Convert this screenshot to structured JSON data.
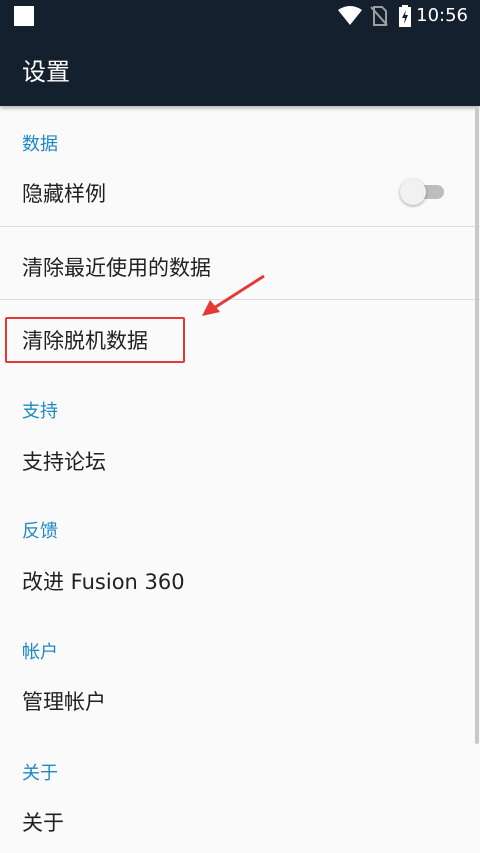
{
  "status_bar": {
    "time": "10:56",
    "icons": [
      "notification-icon",
      "wifi-icon",
      "no-sim-icon",
      "battery-charging-icon"
    ]
  },
  "app_bar": {
    "title": "设置"
  },
  "sections": {
    "data": {
      "header": "数据",
      "hide_samples": {
        "label": "隐藏样例",
        "toggle_on": false
      },
      "clear_recent": "清除最近使用的数据",
      "clear_offline": "清除脱机数据"
    },
    "support": {
      "header": "支持",
      "forum": "支持论坛"
    },
    "feedback": {
      "header": "反馈",
      "improve": "改进 Fusion 360"
    },
    "account": {
      "header": "帐户",
      "manage": "管理帐户"
    },
    "about": {
      "header": "关于",
      "about": "关于"
    }
  },
  "annotation": {
    "color": "#e53935"
  },
  "colors": {
    "header_blue": "#1e88c6",
    "app_bar": "#15202e"
  }
}
